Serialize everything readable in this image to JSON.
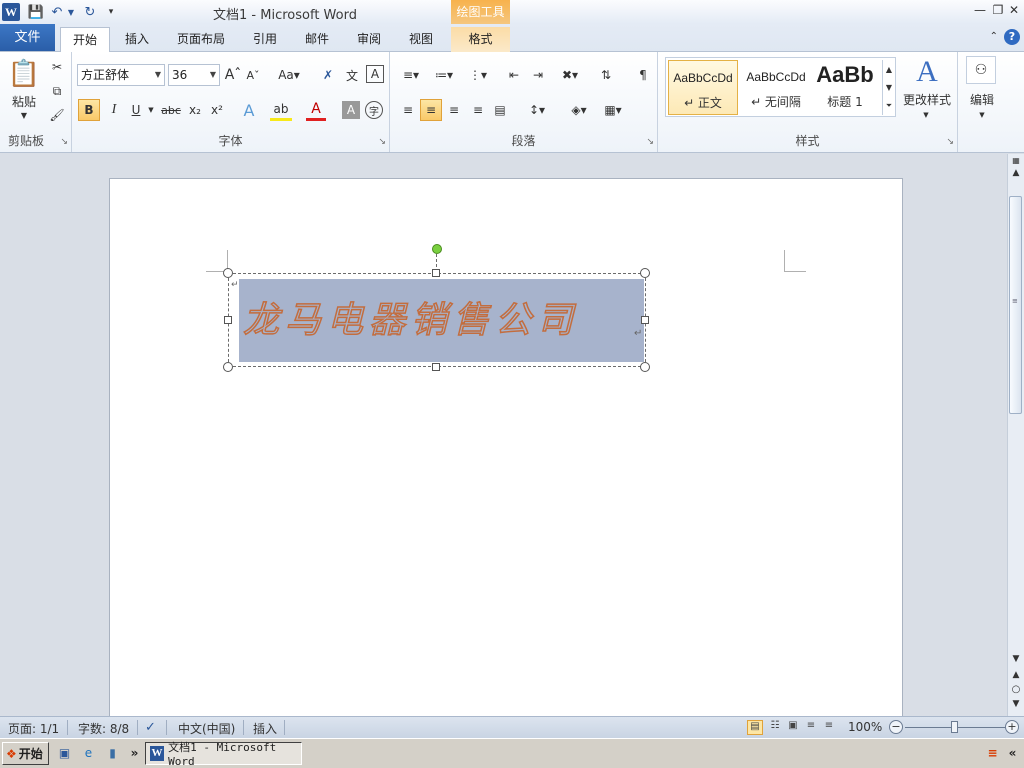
{
  "window": {
    "title": "文档1  -  Microsoft Word",
    "context_tool_title": "绘图工具",
    "app_icon": "W"
  },
  "tabs": {
    "file": "文件",
    "home": "开始",
    "insert": "插入",
    "page_layout": "页面布局",
    "references": "引用",
    "mailings": "邮件",
    "review": "审阅",
    "view": "视图",
    "format": "格式"
  },
  "clipboard": {
    "paste_label": "粘贴",
    "group_label": "剪贴板"
  },
  "font": {
    "family": "方正舒体",
    "size": "36",
    "group_label": "字体"
  },
  "paragraph": {
    "group_label": "段落"
  },
  "styles": {
    "group_label": "样式",
    "items": [
      {
        "sample": "AaBbCcDd",
        "name": "↵ 正文"
      },
      {
        "sample": "AaBbCcDd",
        "name": "↵ 无间隔"
      },
      {
        "sample": "AaBb",
        "name": "标题 1"
      }
    ],
    "change_styles_label": "更改样式"
  },
  "editing": {
    "label": "编辑"
  },
  "document": {
    "wordart_text": "龙马电器销售公司"
  },
  "statusbar": {
    "page": "页面: 1/1",
    "word_count": "字数: 8/8",
    "language": "中文(中国)",
    "mode": "插入",
    "zoom": "100%",
    "zoom_level_percent": 100
  },
  "taskbar": {
    "start_label": "开始",
    "word_task_label": "文档1 - Microsoft Word"
  }
}
